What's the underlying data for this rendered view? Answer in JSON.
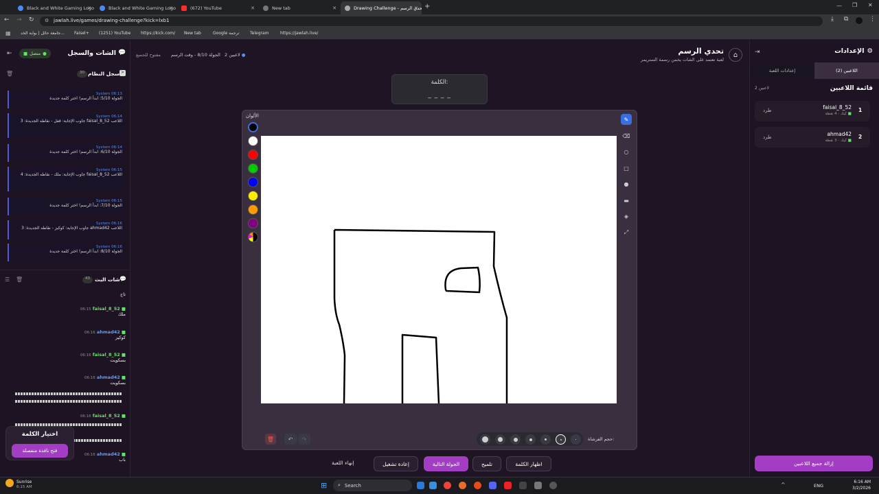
{
  "browser": {
    "tabs": [
      {
        "title": "Black and White Gaming Logo"
      },
      {
        "title": "Black and White Gaming Logo"
      },
      {
        "title": "(672) YouTube"
      },
      {
        "title": "New tab"
      },
      {
        "title": "Drawing Challenge - تحدي الرسم"
      }
    ],
    "url": "jawlah.live/games/drawing-challenge?kick=lxb1",
    "bookmarks": [
      "جامعة حائل | بوابة الخد...",
      "Faisel+",
      "(1251) YouTube",
      "https://kick.com/",
      "New tab",
      "Google ترجمة",
      "Telegram",
      "https://jawlah.live/"
    ]
  },
  "left": {
    "title": "الشات والسجل",
    "status": "متصل",
    "syslog_title": "سجل النظام",
    "syslog_count": "30",
    "logs": [
      {
        "time": "06:13",
        "src": "System",
        "text": "الجولة 5/10: ابدأ الرسم! اختر كلمة جديدة"
      },
      {
        "time": "06:14",
        "src": "System",
        "text": "اللاعب faisal_8_52 جاوب الإجابة: قفل - نقاطه الجديدة: 3"
      },
      {
        "time": "06:14",
        "src": "System",
        "text": "الجولة 6/10: ابدأ الرسم! اختر كلمة جديدة"
      },
      {
        "time": "06:15",
        "src": "System",
        "text": "اللاعب faisal_8_52 جاوب الإجابة: ملك - نقاطه الجديدة: 4"
      },
      {
        "time": "06:15",
        "src": "System",
        "text": "الجولة 7/10: ابدأ الرسم! اختر كلمة جديدة"
      },
      {
        "time": "06:16",
        "src": "System",
        "text": "اللاعب ahmad42 جاوب الإجابة: كوكيز - نقاطه الجديدة: 3"
      },
      {
        "time": "06:16",
        "src": "System",
        "text": "الجولة 8/10: ابدأ الرسم! اختر كلمة جديدة"
      }
    ],
    "chat_title": "شات البث",
    "chat_count": "43",
    "messages": [
      {
        "time": "",
        "user": "",
        "text": "تاج"
      },
      {
        "time": "06:15",
        "user": "faisal_8_52",
        "text": "ملك"
      },
      {
        "time": "06:16",
        "user": "ahmad42",
        "text": "كوكيز"
      },
      {
        "time": "06:16",
        "user": "faisal_8_52",
        "text": "بسكويت"
      },
      {
        "time": "06:16",
        "user": "ahmad42",
        "text": "بسكويت"
      },
      {
        "time": "06:16",
        "user": "faisal_8_52",
        "text": ""
      },
      {
        "time": "06:16",
        "user": "ahmad42",
        "text": "باب"
      }
    ],
    "word_choice_title": "اختيار الكلمة",
    "word_choice_button": "فتح نافذة منفصلة"
  },
  "center": {
    "game_title": "تحدي الرسم",
    "game_subtitle": "لعبة تعتمد على الشات يخمن رسمة الستريمر",
    "players_count": "2 لاعبين",
    "round_info": "الجولة 8/10 - وقت الرسم",
    "open_to_all": "مفتوح للجميع",
    "word_label": "الكلمة:",
    "word_mask": "_ _ _ _",
    "colors_label": "الألوان",
    "brush_size_label": "حجم الفرشاة:",
    "buttons": {
      "end_game": "إنهاء اللعبة",
      "restart": "إعادة تشغيل",
      "next_round": "الجولة التالية",
      "hint": "تلميح",
      "reveal_word": "اظهار الكلمة"
    }
  },
  "right": {
    "title": "الإعدادات",
    "tab_players": "اللاعبين (2)",
    "tab_settings": "إعدادات اللعبة",
    "list_title": "قائمة اللاعبين",
    "list_count": "2 لاعبين",
    "players": [
      {
        "rank": "1",
        "name": "faisal_8_52",
        "meta": "كيك - 4 نقطة",
        "kick": "طرد"
      },
      {
        "rank": "2",
        "name": "ahmad42",
        "meta": "كيك - 3 نقطة",
        "kick": "طرد"
      }
    ],
    "remove_all": "إزالة جميع اللاعبين"
  },
  "taskbar": {
    "weather": "Sunrise",
    "weather_time": "6:15 AM",
    "search": "Search",
    "lang": "ENG",
    "time": "6:16 AM",
    "date": "3/2/2026"
  },
  "palette": [
    "#000000",
    "#ffffff",
    "#ff0000",
    "#00cc00",
    "#0000ff",
    "#ffee00",
    "#ff9900",
    "#800080"
  ],
  "accent": "#a23dc4"
}
